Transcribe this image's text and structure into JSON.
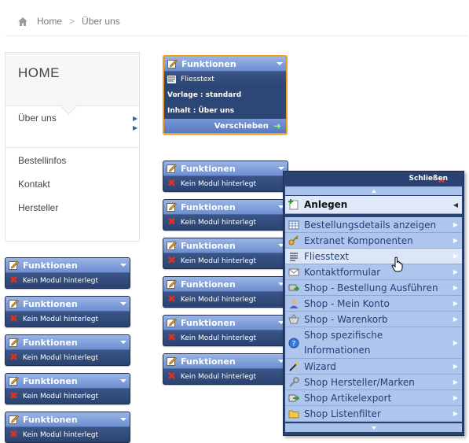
{
  "breadcrumb": {
    "home": "Home",
    "separator": ">",
    "current": "Über uns"
  },
  "sidebar": {
    "title": "HOME",
    "items": [
      "Über uns",
      "Bestellinfos",
      "Kontakt",
      "Hersteller"
    ]
  },
  "widgets": {
    "title": "Funktionen",
    "no_module": "Kein Modul hinterlegt",
    "selected": {
      "title": "Funktionen",
      "module": "Fliesstext",
      "template": "Vorlage : standard",
      "content": "Inhalt : Über uns",
      "move": "Verschieben"
    }
  },
  "menu": {
    "close": "Schließen",
    "header": "Anlegen",
    "items": [
      {
        "label": "Bestellungsdetails anzeigen",
        "icon": "table-icon"
      },
      {
        "label": "Extranet Komponenten",
        "icon": "key-icon"
      },
      {
        "label": "Fliesstext",
        "icon": "text-icon"
      },
      {
        "label": "Kontaktformular",
        "icon": "mail-icon"
      },
      {
        "label": "Shop - Bestellung Ausführen",
        "icon": "cart-go-icon"
      },
      {
        "label": "Shop - Mein Konto",
        "icon": "user-icon"
      },
      {
        "label": "Shop - Warenkorb",
        "icon": "basket-icon"
      },
      {
        "label": "Shop spezifische Informationen",
        "icon": "info-icon"
      },
      {
        "label": "Wizard",
        "icon": "wand-icon"
      },
      {
        "label": "Shop Hersteller/Marken",
        "icon": "wrench-icon"
      },
      {
        "label": "Shop Artikelexport",
        "icon": "export-icon"
      },
      {
        "label": "Shop Listenfilter",
        "icon": "folder-icon"
      }
    ]
  },
  "colors": {
    "widget_bg": "#2c4675",
    "widget_header": "#7f9ed9",
    "menu_item_bg": "#aec6ee",
    "selected_border": "#f0a020"
  }
}
